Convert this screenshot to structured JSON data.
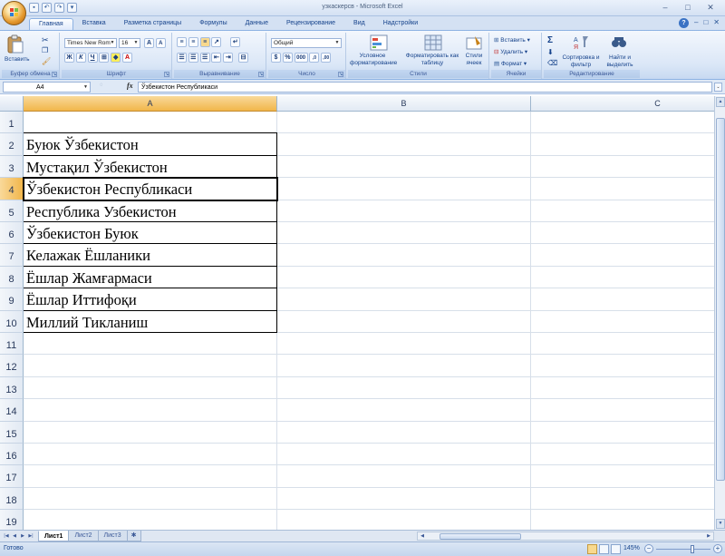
{
  "window": {
    "title": "узкаскерсв - Microsoft Excel"
  },
  "quick_access": [
    "save-icon",
    "undo-icon",
    "redo-icon",
    "customize-icon"
  ],
  "tabs": [
    {
      "label": "Главная",
      "active": true
    },
    {
      "label": "Вставка"
    },
    {
      "label": "Разметка страницы"
    },
    {
      "label": "Формулы"
    },
    {
      "label": "Данные"
    },
    {
      "label": "Рецензирование"
    },
    {
      "label": "Вид"
    },
    {
      "label": "Надстройки"
    }
  ],
  "ribbon": {
    "clipboard": {
      "label": "Буфер обмена",
      "paste": "Вставить"
    },
    "font": {
      "label": "Шрифт",
      "name": "Times New Rom",
      "size": "16",
      "bold": "Ж",
      "italic": "К",
      "underline": "Ч"
    },
    "alignment": {
      "label": "Выравнивание"
    },
    "number": {
      "label": "Число",
      "format": "Общий",
      "percent": "%",
      "thousands": "000",
      "dec_inc": ",0",
      "dec_dec": ",00"
    },
    "styles": {
      "label": "Стили",
      "conditional": "Условное форматирование",
      "as_table": "Форматировать как таблицу",
      "cell_styles": "Стили ячеек"
    },
    "cells": {
      "label": "Ячейки",
      "insert": "Вставить",
      "delete": "Удалить",
      "format": "Формат"
    },
    "editing": {
      "label": "Редактирование",
      "sort": "Сортировка и фильтр",
      "find": "Найти и выделить",
      "sum": "Σ"
    }
  },
  "formula_bar": {
    "name_box": "A4",
    "fx": "fx",
    "content": "Ўзбекистон Республикаси"
  },
  "grid": {
    "columns": [
      {
        "label": "A",
        "selected": true
      },
      {
        "label": "B"
      },
      {
        "label": "C"
      }
    ],
    "rows": [
      "1",
      "2",
      "3",
      "4",
      "5",
      "6",
      "7",
      "8",
      "9",
      "10",
      "11",
      "12",
      "13",
      "14",
      "15",
      "16",
      "17",
      "18",
      "19"
    ],
    "selected_row": "4",
    "cells": [
      {
        "row": "2",
        "text": "Буюк Ўзбекистон"
      },
      {
        "row": "3",
        "text": "Мустақил Ўзбекистон"
      },
      {
        "row": "4",
        "text": "Ўзбекистон Республикаси",
        "active": true
      },
      {
        "row": "5",
        "text": "Республика Узбекистон"
      },
      {
        "row": "6",
        "text": "Ўзбекистон Буюк"
      },
      {
        "row": "7",
        "text": "Келажак Ёшланики"
      },
      {
        "row": "8",
        "text": "Ёшлар Жамғармаси"
      },
      {
        "row": "9",
        "text": "Ёшлар Иттифоқи"
      },
      {
        "row": "10",
        "text": "Миллий Тикланиш"
      }
    ]
  },
  "sheets": [
    {
      "label": "Лист1",
      "active": true
    },
    {
      "label": "Лист2"
    },
    {
      "label": "Лист3"
    }
  ],
  "status": {
    "text": "Готово",
    "zoom": "145%"
  }
}
